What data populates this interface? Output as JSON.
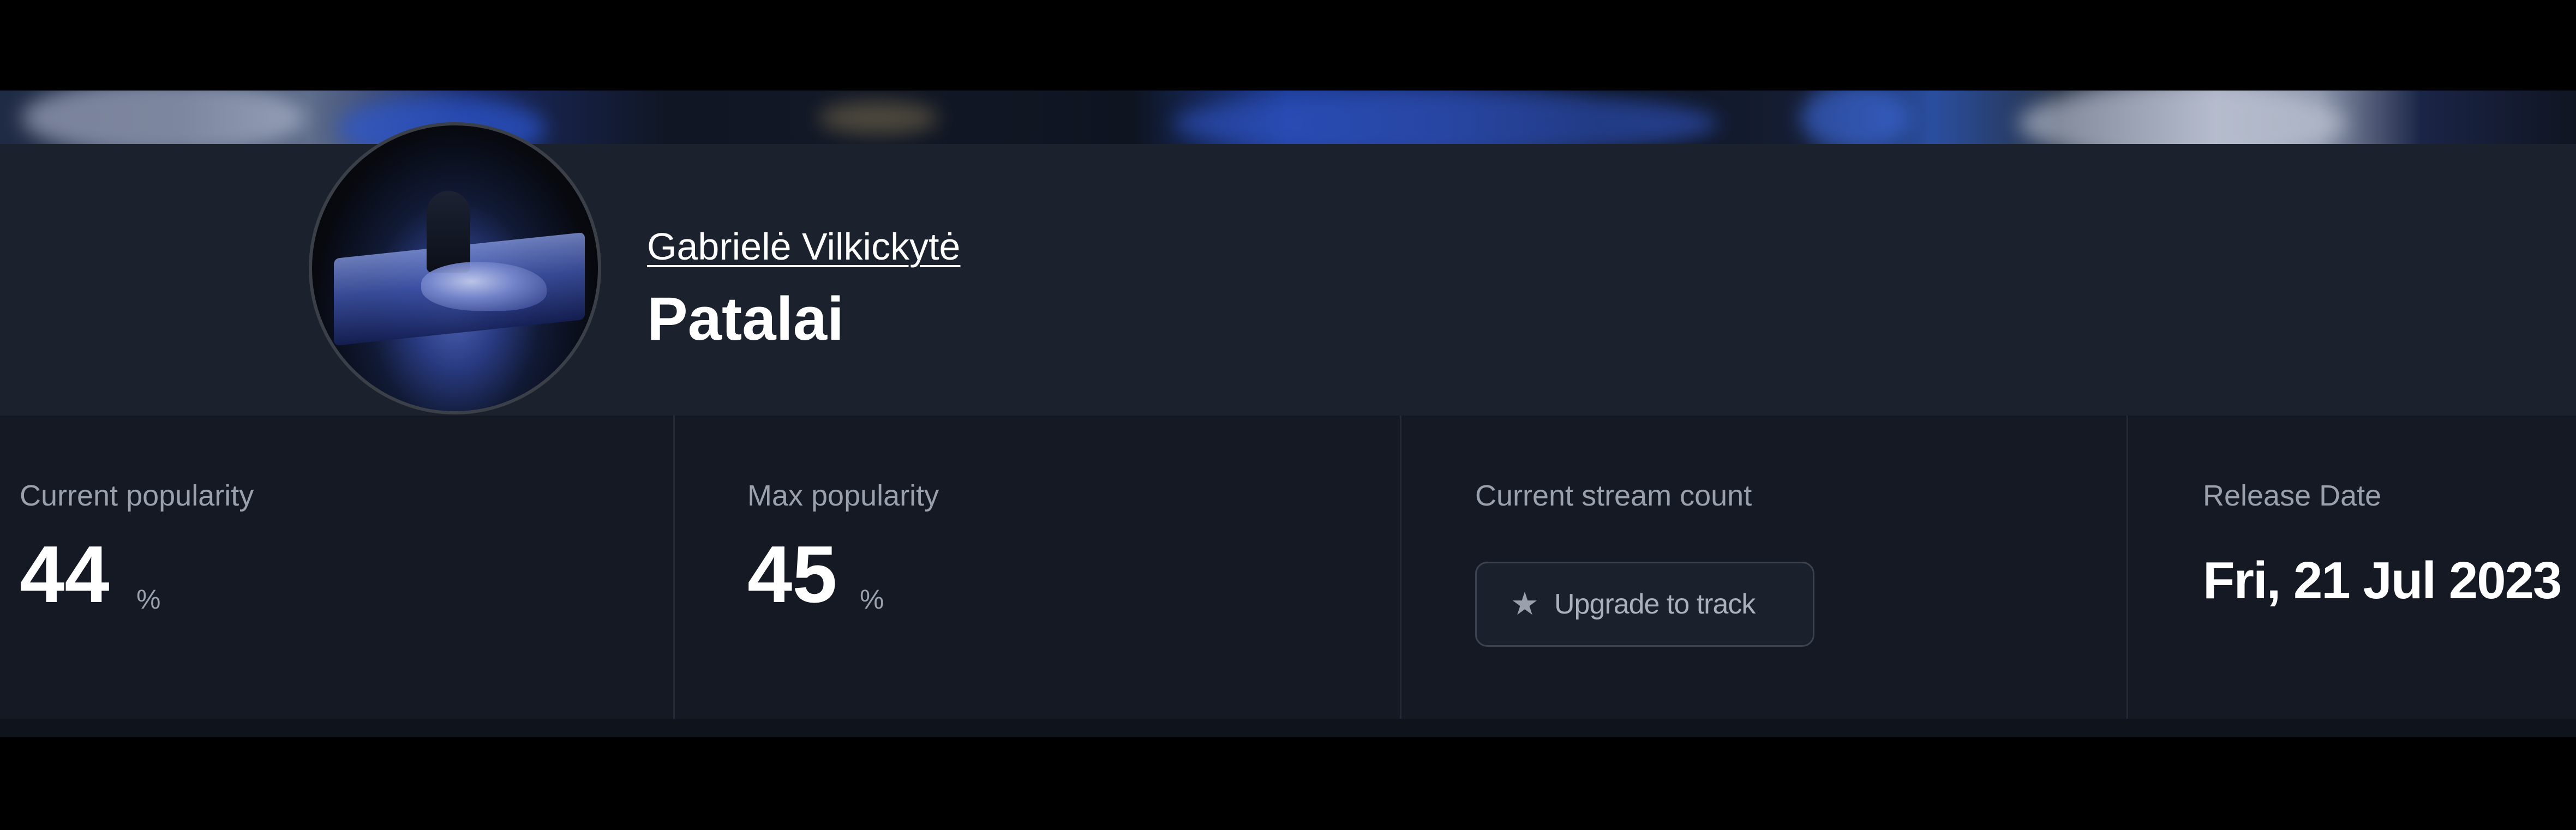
{
  "track": {
    "artist": "Gabrielė Vilkickytė",
    "title": "Patalai",
    "cover_icon": "album-cover-image"
  },
  "stats": {
    "current_popularity": {
      "label": "Current popularity",
      "value": "44",
      "unit": "%"
    },
    "max_popularity": {
      "label": "Max popularity",
      "value": "45",
      "unit": "%"
    },
    "stream_count": {
      "label": "Current stream count",
      "button_label": "Upgrade to track",
      "button_icon": "star-icon"
    },
    "release_date": {
      "label": "Release Date",
      "value": "Fri, 21 Jul 2023"
    }
  },
  "colors": {
    "header_bg": "#1c222d",
    "stats_bg": "#141924",
    "text_primary": "#ffffff",
    "text_secondary": "#9aa1ad"
  }
}
